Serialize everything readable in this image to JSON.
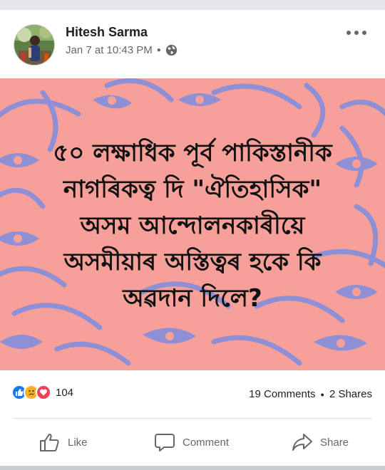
{
  "post": {
    "author": "Hitesh Sarma",
    "timestamp": "Jan 7 at 10:43 PM",
    "privacy_icon": "globe-icon",
    "image_text": "৫০ লক্ষাধিক পূৰ্ব পাকিস্তানীক\nনাগৰিকত্ব দি \"ঐতিহাসিক\"\nঅসম আন্দোলনকাৰীয়ে\nঅসমীয়াৰ অস্তিত্বৰ হকে কি\nঅৱদান দিলে?",
    "image_colors": {
      "background": "#f7a09a",
      "pattern": "#8f8fd6"
    }
  },
  "reactions": {
    "icons": [
      "like-icon",
      "sad-icon",
      "love-icon"
    ],
    "count": "104",
    "comments": "19 Comments",
    "shares": "2 Shares"
  },
  "actions": {
    "like": "Like",
    "comment": "Comment",
    "share": "Share"
  }
}
